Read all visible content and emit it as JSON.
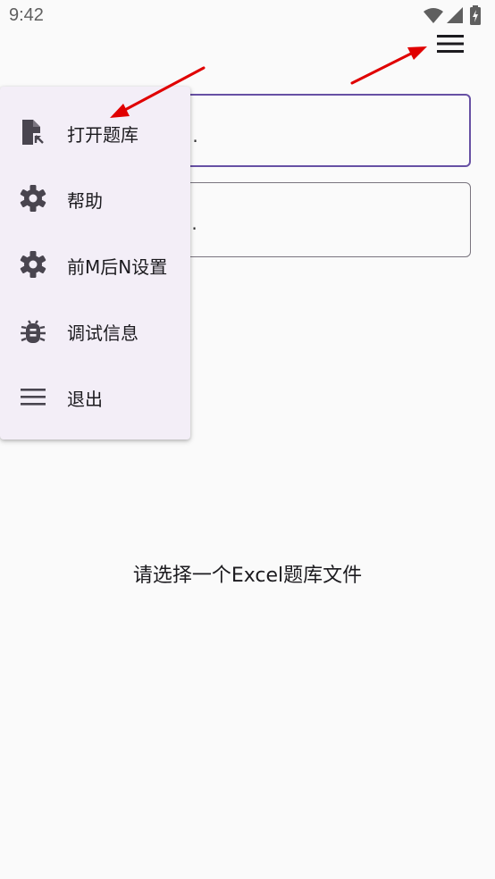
{
  "status_bar": {
    "time": "9:42",
    "icons": [
      "wifi-icon",
      "signal-icon",
      "battery-icon"
    ]
  },
  "toolbar": {
    "menu_icon": "hamburger-menu-icon"
  },
  "fields": [
    {
      "text": "..",
      "focused": true
    },
    {
      "text": "..",
      "focused": false
    }
  ],
  "menu": {
    "items": [
      {
        "label": "打开题库",
        "icon": "open-file-icon"
      },
      {
        "label": "帮助",
        "icon": "gear-icon"
      },
      {
        "label": "前M后N设置",
        "icon": "gear-icon"
      },
      {
        "label": "调试信息",
        "icon": "bug-icon"
      },
      {
        "label": "退出",
        "icon": "hamburger-lines-icon"
      }
    ]
  },
  "main": {
    "prompt": "请选择一个Excel题库文件"
  },
  "colors": {
    "accent": "#6750a4",
    "menu_bg": "#f3eef7",
    "background": "#fafafa",
    "icon": "#49454f",
    "annotation_arrow": "#e00000"
  }
}
